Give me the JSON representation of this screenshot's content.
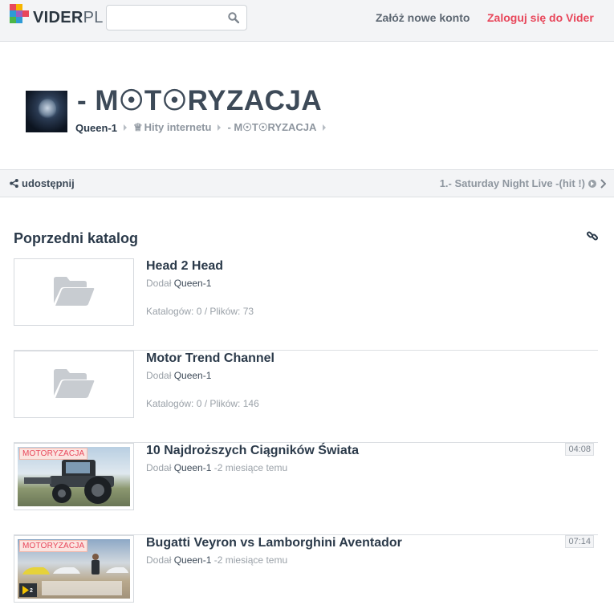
{
  "header": {
    "logo_text": "VIDER",
    "logo_suffix": "PL",
    "search_placeholder": "",
    "register_label": "Załóż nowe konto",
    "login_label": "Zaloguj się do Vider"
  },
  "folder": {
    "title": "- M☉T☉RYZACJA",
    "breadcrumb": [
      "Queen-1",
      "Hity internetu",
      "- M☉T☉RYZACJA"
    ]
  },
  "sharebar": {
    "share_label": "udostępnij",
    "next_label": "1.- Saturday Night Live -(hit !)"
  },
  "section": {
    "title": "Poprzedni katalog"
  },
  "colors": {
    "accent": "#e8475b",
    "text_dark": "#2b3a4a",
    "muted": "#9aa1a8"
  },
  "items": [
    {
      "type": "folder",
      "title": "Head 2 Head",
      "added_prefix": "Dodał",
      "author": "Queen-1",
      "stats": "Katalogów: 0 / Plików: 73"
    },
    {
      "type": "folder",
      "title": "Motor Trend Channel",
      "added_prefix": "Dodał",
      "author": "Queen-1",
      "stats": "Katalogów: 0 / Plików: 146"
    },
    {
      "type": "video",
      "title": "10 Najdroższych Ciągników Świata",
      "added_prefix": "Dodał",
      "author": "Queen-1",
      "age": "-2 miesiące temu",
      "duration": "04:08",
      "category": "MOTORYZACJA"
    },
    {
      "type": "video",
      "title": "Bugatti Veyron vs Lamborghini Aventador",
      "added_prefix": "Dodał",
      "author": "Queen-1",
      "age": "-2 miesiące temu",
      "duration": "07:14",
      "category": "MOTORYZACJA"
    }
  ]
}
